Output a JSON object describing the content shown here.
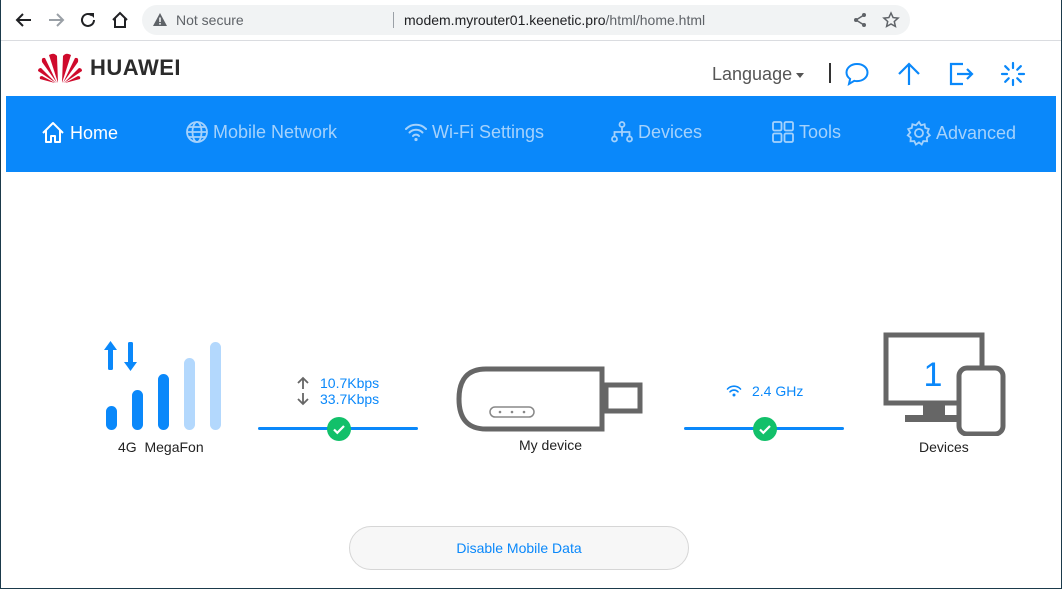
{
  "browser": {
    "not_secure": "Not secure",
    "url_host": "modem.myrouter01.keenetic.pro",
    "url_path": "/html/home.html"
  },
  "header": {
    "brand": "HUAWEI",
    "language_label": "Language",
    "icons": [
      "message-icon",
      "update-icon",
      "logout-icon",
      "loading-icon"
    ]
  },
  "nav": {
    "items": [
      {
        "label": "Home",
        "icon": "home-icon"
      },
      {
        "label": "Mobile Network",
        "icon": "globe-icon"
      },
      {
        "label": "Wi-Fi Settings",
        "icon": "wifi-icon"
      },
      {
        "label": "Devices",
        "icon": "devices-tree-icon"
      },
      {
        "label": "Tools",
        "icon": "tools-grid-icon"
      },
      {
        "label": "Advanced",
        "icon": "gear-icon"
      }
    ],
    "active": "Home"
  },
  "status": {
    "network_type": "4G",
    "operator": "MegaFon",
    "upload_speed": "10.7Kbps",
    "download_speed": "33.7Kbps",
    "device_label": "My device",
    "wifi_band": "2.4 GHz",
    "devices_count": "1",
    "devices_label": "Devices",
    "signal_bars": 3,
    "signal_bars_total": 5
  },
  "actions": {
    "disable_mobile_data": "Disable Mobile Data"
  },
  "colors": {
    "brand_blue": "#0a88fa",
    "check_green": "#12c06a",
    "huawei_red": "#cf0a2c"
  }
}
